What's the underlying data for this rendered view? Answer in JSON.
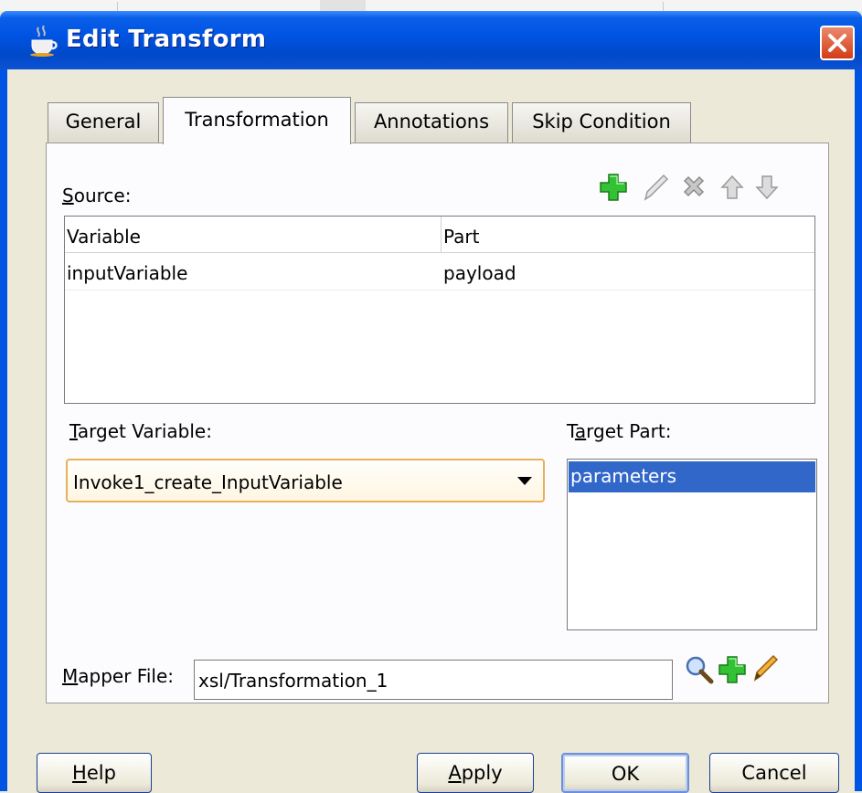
{
  "window": {
    "title": "Edit Transform",
    "close_icon": "close-icon",
    "app_icon": "coffee-cup-icon"
  },
  "tabs": [
    {
      "label": "General",
      "active": false
    },
    {
      "label": "Transformation",
      "active": true
    },
    {
      "label": "Annotations",
      "active": false
    },
    {
      "label": "Skip Condition",
      "active": false
    }
  ],
  "source": {
    "label": "Source:",
    "toolbar": [
      "add-icon",
      "edit-icon",
      "delete-icon",
      "move-up-icon",
      "move-down-icon"
    ],
    "columns": [
      "Variable",
      "Part"
    ],
    "rows": [
      {
        "variable": "inputVariable",
        "part": "payload"
      }
    ]
  },
  "target_variable": {
    "label": "Target Variable:",
    "selected": "Invoke1_create_InputVariable"
  },
  "target_part": {
    "label": "Target Part:",
    "items": [
      "parameters"
    ],
    "selected": "parameters"
  },
  "mapper_file": {
    "label": "Mapper File:",
    "value": "xsl/Transformation_1",
    "icons": [
      "search-icon",
      "add-icon",
      "edit-icon"
    ]
  },
  "buttons": {
    "help": "Help",
    "apply": "Apply",
    "ok": "OK",
    "cancel": "Cancel"
  },
  "colors": {
    "titlebar": "#0054e3",
    "selection": "#3167c9",
    "add_icon": "#2eb82e",
    "close_button": "#d33c16"
  }
}
